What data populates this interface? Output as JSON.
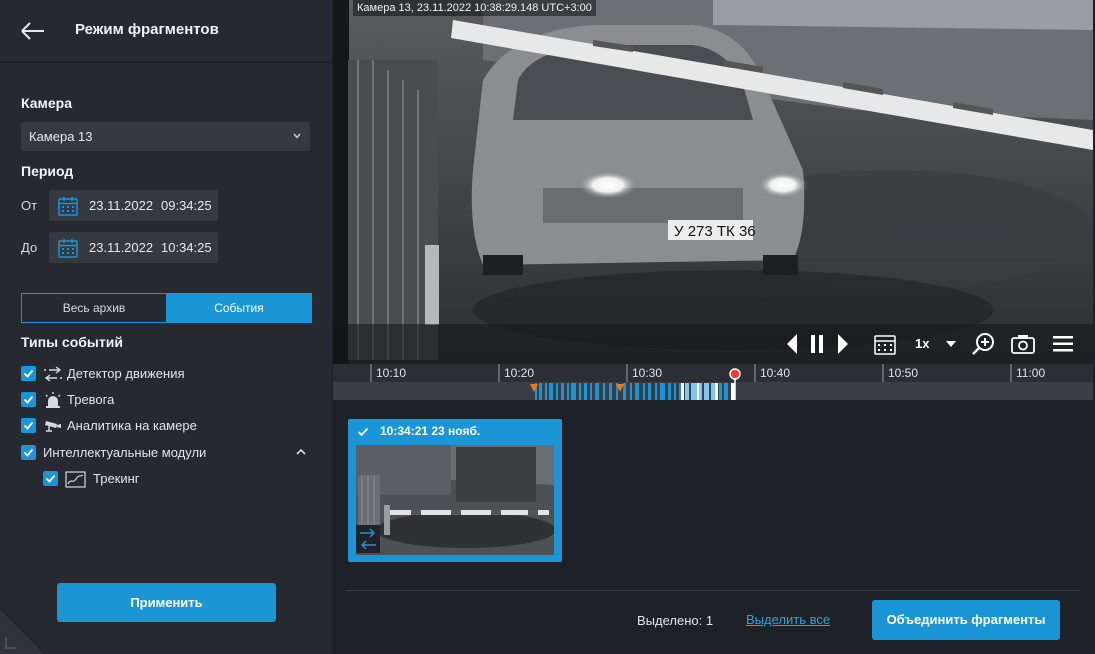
{
  "sidebar": {
    "title": "Режим фрагментов",
    "camera_label": "Камера",
    "camera_value": "Камера 13",
    "period_label": "Период",
    "from_label": "От",
    "from_date": "23.11.2022",
    "from_time": "09:34:25",
    "to_label": "До",
    "to_date": "23.11.2022",
    "to_time": "10:34:25",
    "mode_options": [
      "Весь архив",
      "События"
    ],
    "mode_selected": "События",
    "event_types_label": "Типы событий",
    "event_types": [
      {
        "label": "Детектор движения",
        "checked": true,
        "icon": "motion-icon"
      },
      {
        "label": "Тревога",
        "checked": true,
        "icon": "alarm-icon"
      },
      {
        "label": "Аналитика на камере",
        "checked": true,
        "icon": "camera-analytics-icon"
      },
      {
        "label": "Интеллектуальные модули",
        "checked": true,
        "icon": "chevron-up-icon"
      },
      {
        "label": "Трекинг",
        "checked": true,
        "icon": "tracking-icon"
      }
    ],
    "apply_label": "Применить"
  },
  "video": {
    "timestamp": "Камера 13, 23.11.2022 10:38:29.148 UTC+3:00",
    "speed": "1x",
    "plate_text": "У 273 ТК 36"
  },
  "timeline": {
    "ticks": [
      "10:10",
      "10:20",
      "10:30",
      "10:40",
      "10:50",
      "11:00"
    ]
  },
  "fragments": [
    {
      "title": "10:34:21 23 нояб.",
      "selected": true
    }
  ],
  "footer": {
    "selected_text": "Выделено: 1",
    "select_all": "Выделить все",
    "merge_label": "Объединить фрагменты"
  },
  "colors": {
    "accent": "#1a96d6",
    "sidebar_bg": "#262930",
    "main_bg": "#1f2128",
    "marker_red": "#e8412b",
    "marker_orange": "#f07a1a"
  }
}
